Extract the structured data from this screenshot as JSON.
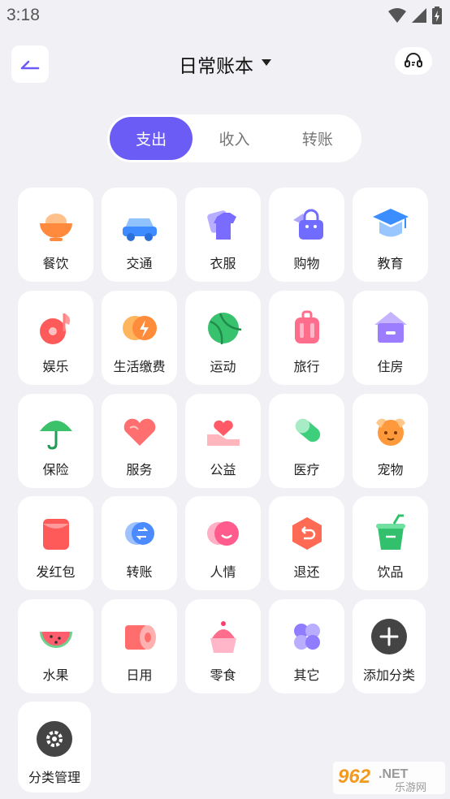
{
  "status_bar": {
    "time": "3:18"
  },
  "header": {
    "title": "日常账本"
  },
  "tabs": [
    {
      "label": "支出",
      "active": true
    },
    {
      "label": "收入",
      "active": false
    },
    {
      "label": "转账",
      "active": false
    }
  ],
  "categories": [
    {
      "label": "餐饮",
      "icon": "rice-bowl-icon",
      "color": "#ff8a3d"
    },
    {
      "label": "交通",
      "icon": "car-icon",
      "color": "#3d8bff"
    },
    {
      "label": "衣服",
      "icon": "shirt-icon",
      "color": "#7a6cff"
    },
    {
      "label": "购物",
      "icon": "shopping-bag-icon",
      "color": "#6f6cff"
    },
    {
      "label": "教育",
      "icon": "graduation-cap-icon",
      "color": "#3b8eff"
    },
    {
      "label": "娱乐",
      "icon": "music-disc-icon",
      "color": "#ff5a5a"
    },
    {
      "label": "生活缴费",
      "icon": "lightning-bill-icon",
      "color": "#ff8c3a"
    },
    {
      "label": "运动",
      "icon": "ball-icon",
      "color": "#38c26d"
    },
    {
      "label": "旅行",
      "icon": "suitcase-icon",
      "color": "#ff6d8c"
    },
    {
      "label": "住房",
      "icon": "house-icon",
      "color": "#9c7dff"
    },
    {
      "label": "保险",
      "icon": "umbrella-icon",
      "color": "#3cc16b"
    },
    {
      "label": "服务",
      "icon": "heart-icon",
      "color": "#ff6f6f"
    },
    {
      "label": "公益",
      "icon": "heart-hand-icon",
      "color": "#ff5a66"
    },
    {
      "label": "医疗",
      "icon": "pill-icon",
      "color": "#3ecf7c"
    },
    {
      "label": "宠物",
      "icon": "pet-dog-icon",
      "color": "#ff9a3c"
    },
    {
      "label": "发红包",
      "icon": "red-envelope-icon",
      "color": "#ff5a5a"
    },
    {
      "label": "转账",
      "icon": "transfer-icon",
      "color": "#4c8bff"
    },
    {
      "label": "人情",
      "icon": "smile-circle-icon",
      "color": "#ff5b8c"
    },
    {
      "label": "退还",
      "icon": "return-icon",
      "color": "#ff6a55"
    },
    {
      "label": "饮品",
      "icon": "drink-cup-icon",
      "color": "#33c06d"
    },
    {
      "label": "水果",
      "icon": "watermelon-icon",
      "color": "#ff5c6e"
    },
    {
      "label": "日用",
      "icon": "tissue-roll-icon",
      "color": "#ff6d6d"
    },
    {
      "label": "零食",
      "icon": "cupcake-icon",
      "color": "#ff6d8c"
    },
    {
      "label": "其它",
      "icon": "four-leaf-icon",
      "color": "#8f7cff"
    },
    {
      "label": "添加分类",
      "icon": "add-icon",
      "color": "#555555"
    },
    {
      "label": "分类管理",
      "icon": "gear-icon",
      "color": "#555555"
    }
  ],
  "watermark": {
    "text": "962.NET",
    "subtext": "乐游网"
  },
  "colors": {
    "accent": "#6b5cf6",
    "background": "#f1f1f5"
  }
}
